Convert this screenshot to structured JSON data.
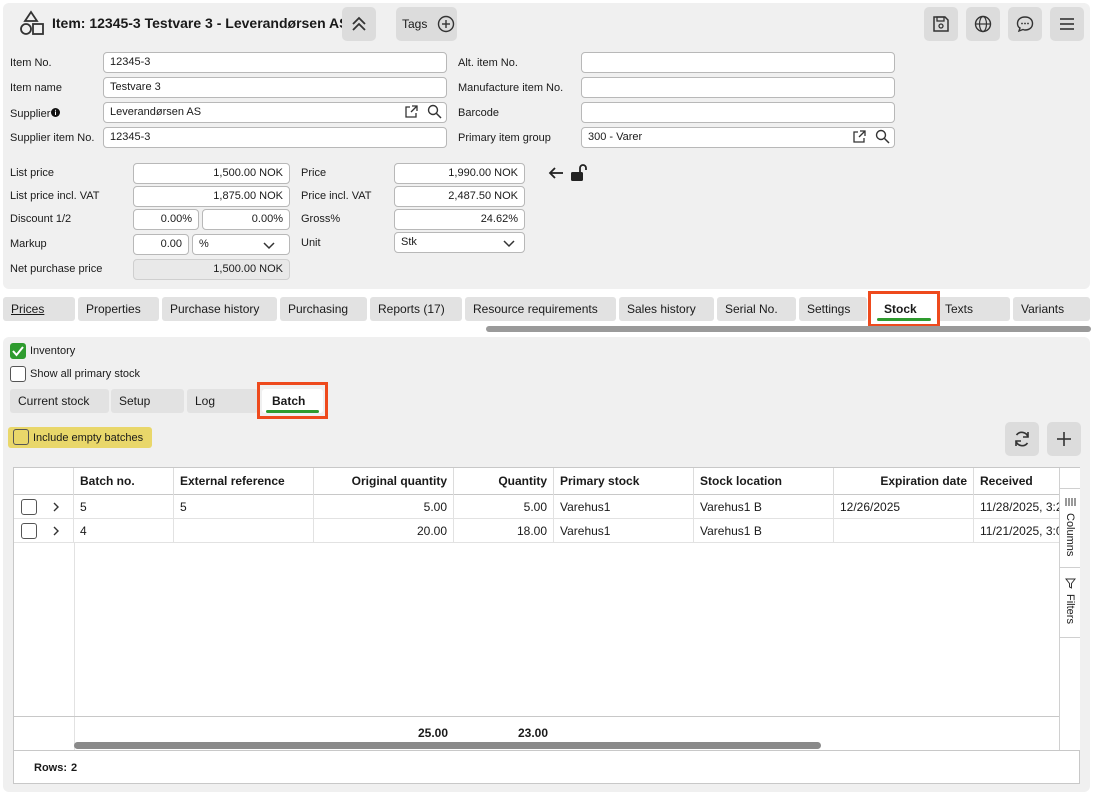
{
  "header": {
    "title": "Item: 12345-3 Testvare 3 - Leverandørsen AS",
    "tags_label": "Tags"
  },
  "form": {
    "item_no_label": "Item No.",
    "item_no": "12345-3",
    "item_name_label": "Item name",
    "item_name": "Testvare 3",
    "supplier_label": "Supplier",
    "supplier": "Leverandørsen AS",
    "supplier_item_no_label": "Supplier item No.",
    "supplier_item_no": "12345-3",
    "alt_item_no_label": "Alt. item No.",
    "alt_item_no": "",
    "manufacture_item_no_label": "Manufacture item No.",
    "manufacture_item_no": "",
    "barcode_label": "Barcode",
    "barcode": "",
    "primary_item_group_label": "Primary item group",
    "primary_item_group": "300 - Varer"
  },
  "pricing": {
    "list_price_label": "List price",
    "list_price": "1,500.00  NOK",
    "list_price_vat_label": "List price incl. VAT",
    "list_price_vat": "1,875.00  NOK",
    "discount_label": "Discount 1/2",
    "discount1": "0.00%",
    "discount2": "0.00%",
    "markup_label": "Markup",
    "markup": "0.00",
    "markup_unit": "%",
    "net_purchase_label": "Net purchase price",
    "net_purchase": "1,500.00  NOK",
    "price_label": "Price",
    "price": "1,990.00  NOK",
    "price_vat_label": "Price incl. VAT",
    "price_vat": "2,487.50  NOK",
    "gross_label": "Gross%",
    "gross": "24.62%",
    "unit_label": "Unit",
    "unit": "Stk"
  },
  "tabs": [
    "Prices",
    "Properties",
    "Purchase history",
    "Purchasing",
    "Reports (17)",
    "Resource requirements",
    "Sales history",
    "Serial No.",
    "Settings",
    "Stock",
    "Texts",
    "Variants"
  ],
  "stock": {
    "inventory_label": "Inventory",
    "show_all_label": "Show all primary stock",
    "subtabs": [
      "Current stock",
      "Setup",
      "Log",
      "Batch"
    ],
    "include_empty_label": "Include empty batches"
  },
  "grid": {
    "columns": [
      "Batch no.",
      "External reference",
      "Original quantity",
      "Quantity",
      "Primary stock",
      "Stock location",
      "Expiration date",
      "Received"
    ],
    "rows": [
      [
        "5",
        "5",
        "5.00",
        "5.00",
        "Varehus1",
        "Varehus1 B",
        "12/26/2025",
        "11/28/2025, 3:2"
      ],
      [
        "4",
        "",
        "20.00",
        "18.00",
        "Varehus1",
        "Varehus1 B",
        "",
        "11/21/2025, 3:0"
      ]
    ],
    "totals": {
      "original_quantity": "25.00",
      "quantity": "23.00"
    },
    "side_columns": "Columns",
    "side_filters": "Filters",
    "rows_label": "Rows:",
    "rows_count": "2"
  }
}
